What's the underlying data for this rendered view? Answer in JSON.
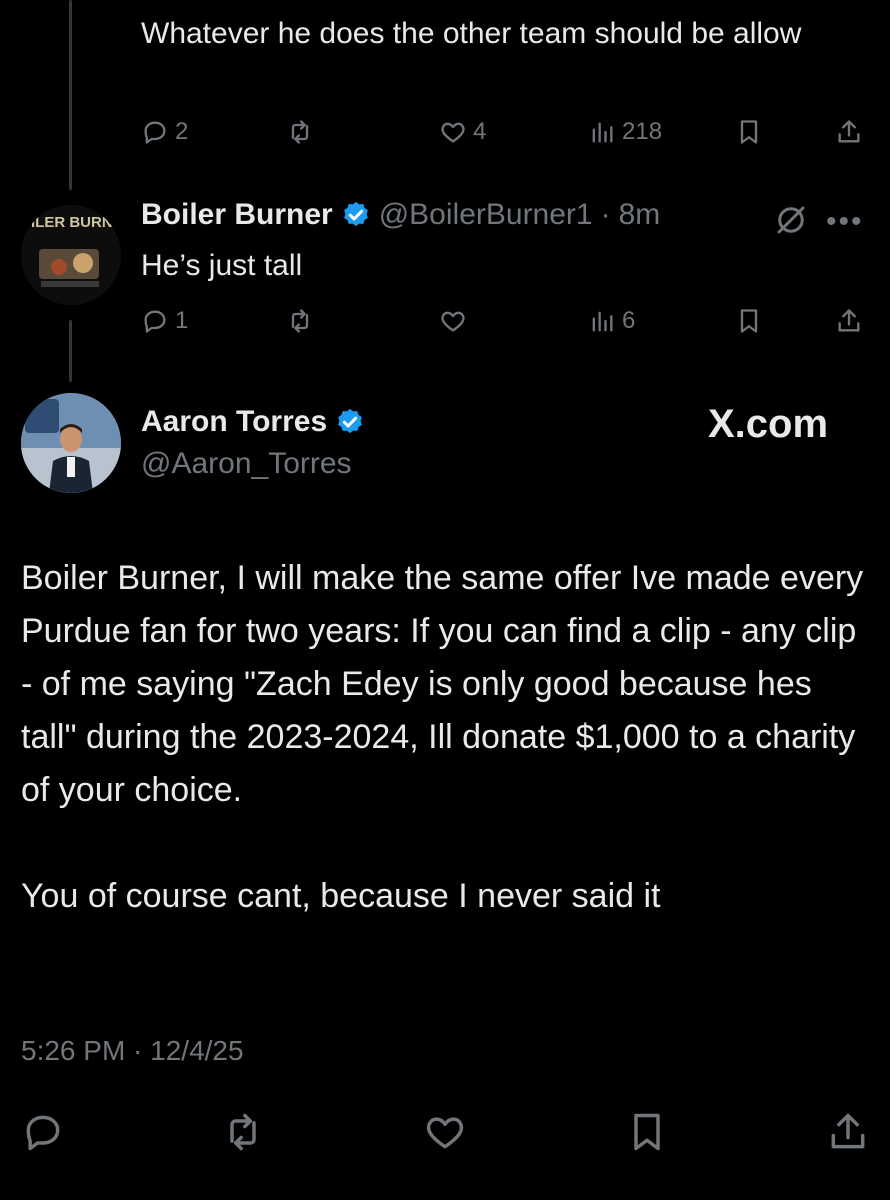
{
  "colors": {
    "background": "#000000",
    "text": "#e7e9ea",
    "muted": "#71767b",
    "verified": "#1d9bf0"
  },
  "top_reply": {
    "text": "Whatever he does the other team should  be allow",
    "replies": "2",
    "likes": "4",
    "views": "218"
  },
  "reply": {
    "avatar_text": "BOILER BURNER",
    "name": "Boiler Burner",
    "handle": "@BoilerBurner1",
    "separator": "·",
    "time": "8m",
    "text": "He’s just tall",
    "replies": "1",
    "views": "6"
  },
  "main_post": {
    "name": "Aaron Torres",
    "handle": "@Aaron_Torres",
    "watermark": "X.com",
    "text": "Boiler Burner, I will make the same offer Ive made every Purdue fan for two years: If you can find a clip - any clip - of me saying \"Zach Edey is only good because hes tall\" during the 2023-2024, Ill donate $1,000 to a charity of your choice.\n\nYou of course cant, because I never said it",
    "timestamp": "5:26 PM · 12/4/25"
  },
  "icons": {
    "reply": "reply-icon",
    "repost": "repost-icon",
    "like": "heart-icon",
    "views": "views-icon",
    "bookmark": "bookmark-icon",
    "share": "share-icon",
    "verified": "verified-badge-icon",
    "grok": "grok-icon",
    "more": "more-icon"
  }
}
